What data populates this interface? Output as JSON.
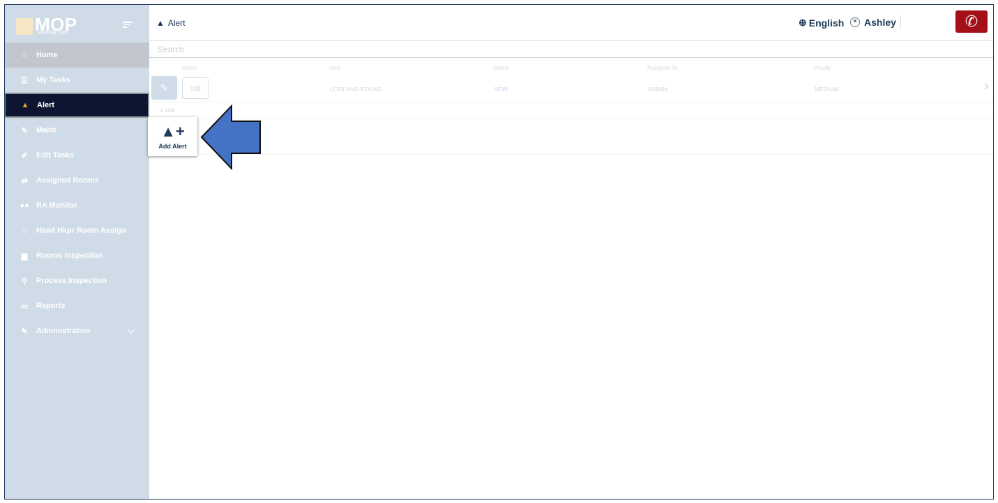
{
  "sidebar": {
    "logo_text": "MOP",
    "logo_sub": "vmmop.com",
    "items": [
      {
        "label": "Home",
        "icon": "home-icon"
      },
      {
        "label": "My Tasks",
        "icon": "tasks-icon"
      },
      {
        "label": "Alert",
        "icon": "warning-icon"
      },
      {
        "label": "Maint",
        "icon": "wrench-icon"
      },
      {
        "label": "Edit Tasks",
        "icon": "edit-icon"
      },
      {
        "label": "Assigned Rooms",
        "icon": "swap-icon"
      },
      {
        "label": "RA Monitor",
        "icon": "binoculars-icon"
      },
      {
        "label": "Head Hkpr Room Assign",
        "icon": "building-icon"
      },
      {
        "label": "Rooms Inspection",
        "icon": "door-icon"
      },
      {
        "label": "Process Inspection",
        "icon": "search-icon"
      },
      {
        "label": "Reports",
        "icon": "report-icon"
      },
      {
        "label": "Administration",
        "icon": "wrench-icon"
      }
    ]
  },
  "header": {
    "title": "Alert",
    "language": "English",
    "user": "Ashley"
  },
  "search": {
    "placeholder": "Search"
  },
  "table": {
    "columns": [
      "Room",
      "Duty",
      "Status",
      "Assigned To",
      "Priority"
    ],
    "rows": [
      {
        "room": "103",
        "duty": "LOST AND FOUND",
        "status": "NEW",
        "assigned_to": "ADMIN",
        "priority": "MEDIUM"
      }
    ],
    "total": "1 total"
  },
  "add_alert": {
    "label": "Add Alert"
  },
  "colors": {
    "sidebar_bg": "#cfdbe6",
    "active_bg": "#0e1530",
    "brand_navy": "#1f3a5a",
    "call_red": "#a50f17",
    "arrow_blue": "#4472c4"
  }
}
